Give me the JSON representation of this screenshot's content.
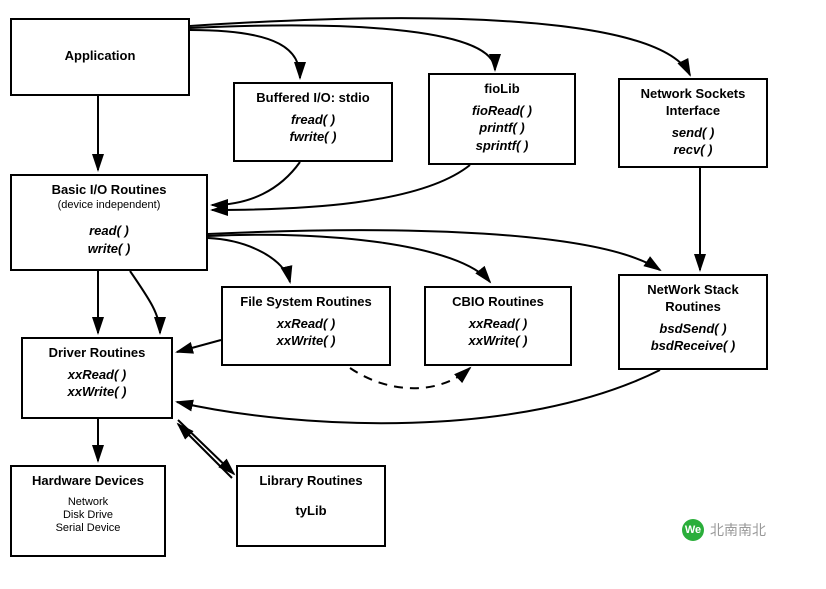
{
  "boxes": {
    "application": {
      "title": "Application"
    },
    "bufferedIO": {
      "title": "Buffered I/O: stdio",
      "funcs": "fread( )\nfwrite( )"
    },
    "fioLib": {
      "title": "fioLib",
      "funcs": "fioRead( )\nprintf( )\nsprintf( )"
    },
    "netSockets": {
      "title": "Network Sockets\nInterface",
      "funcs": "send( )\nrecv( )"
    },
    "basicIO": {
      "title": "Basic I/O Routines",
      "sub": "(device independent)",
      "funcs": "read( )\nwrite( )"
    },
    "fileSys": {
      "title": "File System Routines",
      "funcs": "xxRead( )\nxxWrite( )"
    },
    "cbio": {
      "title": "CBIO Routines",
      "funcs": "xxRead( )\nxxWrite( )"
    },
    "netStack": {
      "title": "NetWork Stack\nRoutines",
      "funcs": "bsdSend( )\nbsdReceive( )"
    },
    "driver": {
      "title": "Driver Routines",
      "funcs": "xxRead( )\nxxWrite( )"
    },
    "hardware": {
      "title": "Hardware Devices",
      "sub": "Network\nDisk Drive\nSerial Device"
    },
    "library": {
      "title": "Library Routines",
      "funcs": "tyLib"
    }
  },
  "watermark": "北南南北"
}
